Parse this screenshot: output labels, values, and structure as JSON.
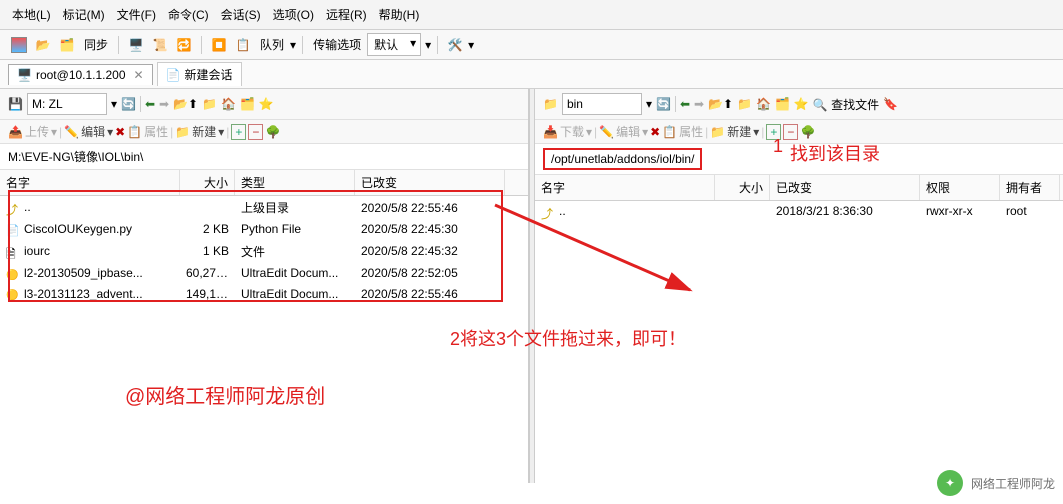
{
  "menu": [
    "本地(L)",
    "标记(M)",
    "文件(F)",
    "命令(C)",
    "会话(S)",
    "选项(O)",
    "远程(R)",
    "帮助(H)"
  ],
  "toolbar": {
    "sync": "同步",
    "queue": "队列",
    "transfer_label": "传输选项",
    "transfer_value": "默认"
  },
  "tabs": {
    "t1": "root@10.1.1.200",
    "t2": "新建会话"
  },
  "left": {
    "drive": "M: ZL",
    "btns": {
      "upload": "上传",
      "edit": "编辑",
      "props": "属性",
      "new": "新建"
    },
    "path": "M:\\EVE-NG\\镜像\\IOL\\bin\\",
    "cols": {
      "name": "名字",
      "size": "大小",
      "type": "类型",
      "chg": "已改变"
    },
    "rows": [
      {
        "icon": "folderup",
        "name": "..",
        "size": "",
        "type": "上级目录",
        "chg": "2020/5/8  22:55:46"
      },
      {
        "icon": "py",
        "name": "CiscoIOUKeygen.py",
        "size": "2 KB",
        "type": "Python File",
        "chg": "2020/5/8  22:45:30"
      },
      {
        "icon": "file",
        "name": "iourc",
        "size": "1 KB",
        "type": "文件",
        "chg": "2020/5/8  22:45:32"
      },
      {
        "icon": "bin",
        "name": "l2-20130509_ipbase...",
        "size": "60,277 ...",
        "type": "UltraEdit Docum...",
        "chg": "2020/5/8  22:52:05"
      },
      {
        "icon": "bin",
        "name": "l3-20131123_advent...",
        "size": "149,100...",
        "type": "UltraEdit Docum...",
        "chg": "2020/5/8  22:55:46"
      }
    ]
  },
  "right": {
    "drive": "bin",
    "btns": {
      "download": "下载",
      "edit": "编辑",
      "props": "属性",
      "new": "新建",
      "find": "查找文件"
    },
    "path": "/opt/unetlab/addons/iol/bin/",
    "cols": {
      "name": "名字",
      "size": "大小",
      "chg": "已改变",
      "perm": "权限",
      "own": "拥有者"
    },
    "rows": [
      {
        "icon": "folderup",
        "name": "..",
        "size": "",
        "chg": "2018/3/21 8:36:30",
        "perm": "rwxr-xr-x",
        "own": "root"
      }
    ]
  },
  "annot": {
    "a1_num": "1",
    "a1": "找到该目录",
    "a2": "2将这3个文件拖过来，即可！",
    "credit": "@网络工程师阿龙原创",
    "wm": "网络工程师阿龙"
  }
}
